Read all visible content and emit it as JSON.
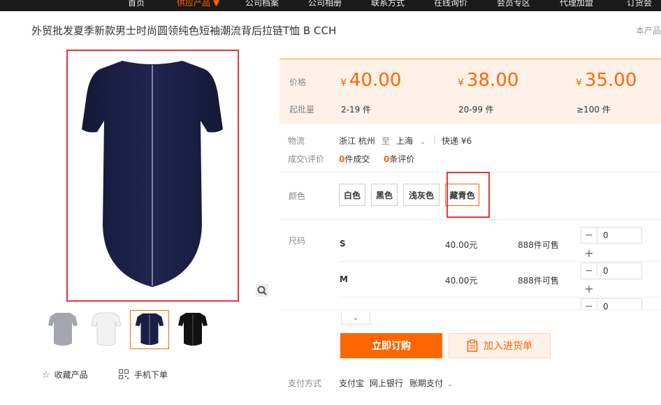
{
  "nav": {
    "items": [
      "首页",
      "供应产品 ▼",
      "公司档案",
      "公司相册",
      "联系方式",
      "在线询价",
      "会员专区",
      "代理加盟",
      "订货会"
    ],
    "active_index": 1
  },
  "product": {
    "title": "外贸批发夏季新款男士时尚圆领纯色短袖潮流背后拉链T恤 B CCH",
    "corner_text": "本产品"
  },
  "gallery": {
    "actions": {
      "favorite": "收藏产品",
      "mobile_order": "手机下单"
    },
    "thumb_colors": [
      "#a3a6ad",
      "#f2f2f2",
      "#1b1f45",
      "#111111"
    ],
    "selected_thumb": 2
  },
  "pricing": {
    "price_label": "价格",
    "moq_label": "起批量",
    "currency": "¥",
    "tiers": [
      {
        "price": "40.00",
        "range": "2-19 件"
      },
      {
        "price": "38.00",
        "range": "20-99 件"
      },
      {
        "price": "35.00",
        "range": "≥100 件"
      }
    ]
  },
  "logistics": {
    "label": "物流",
    "from": "浙江 杭州",
    "to_word": "至",
    "to": "上海",
    "separator": "|",
    "shipping": "快递 ¥6"
  },
  "deals": {
    "label": "成交\\评价",
    "sold_count": "0",
    "sold_text": "件成交",
    "review_count": "0",
    "review_text": "条评价"
  },
  "colors": {
    "label": "颜色",
    "options": [
      "白色",
      "黑色",
      "浅灰色",
      "藏青色"
    ],
    "selected_index": 3
  },
  "sizes": {
    "label": "尺码",
    "rows": [
      {
        "name": "S",
        "price": "40.00元",
        "stock": "888件可售",
        "qty": "0"
      },
      {
        "name": "M",
        "price": "40.00元",
        "stock": "888件可售",
        "qty": "0"
      },
      {
        "name": "",
        "price": "",
        "stock": "",
        "qty": "0"
      }
    ],
    "minus": "−",
    "plus": "+",
    "expand_icon": "chevron-down"
  },
  "actions": {
    "buy_now": "立即订购",
    "add_to_cart": "加入进货单"
  },
  "payment": {
    "label": "支付方式",
    "methods": [
      "支付宝",
      "网上银行",
      "账期支付"
    ]
  },
  "theme": {
    "accent": "#ff6600",
    "highlight_red": "#ee3333",
    "price_bg": "#fdf1e8",
    "shirt": "#1b1f45"
  }
}
